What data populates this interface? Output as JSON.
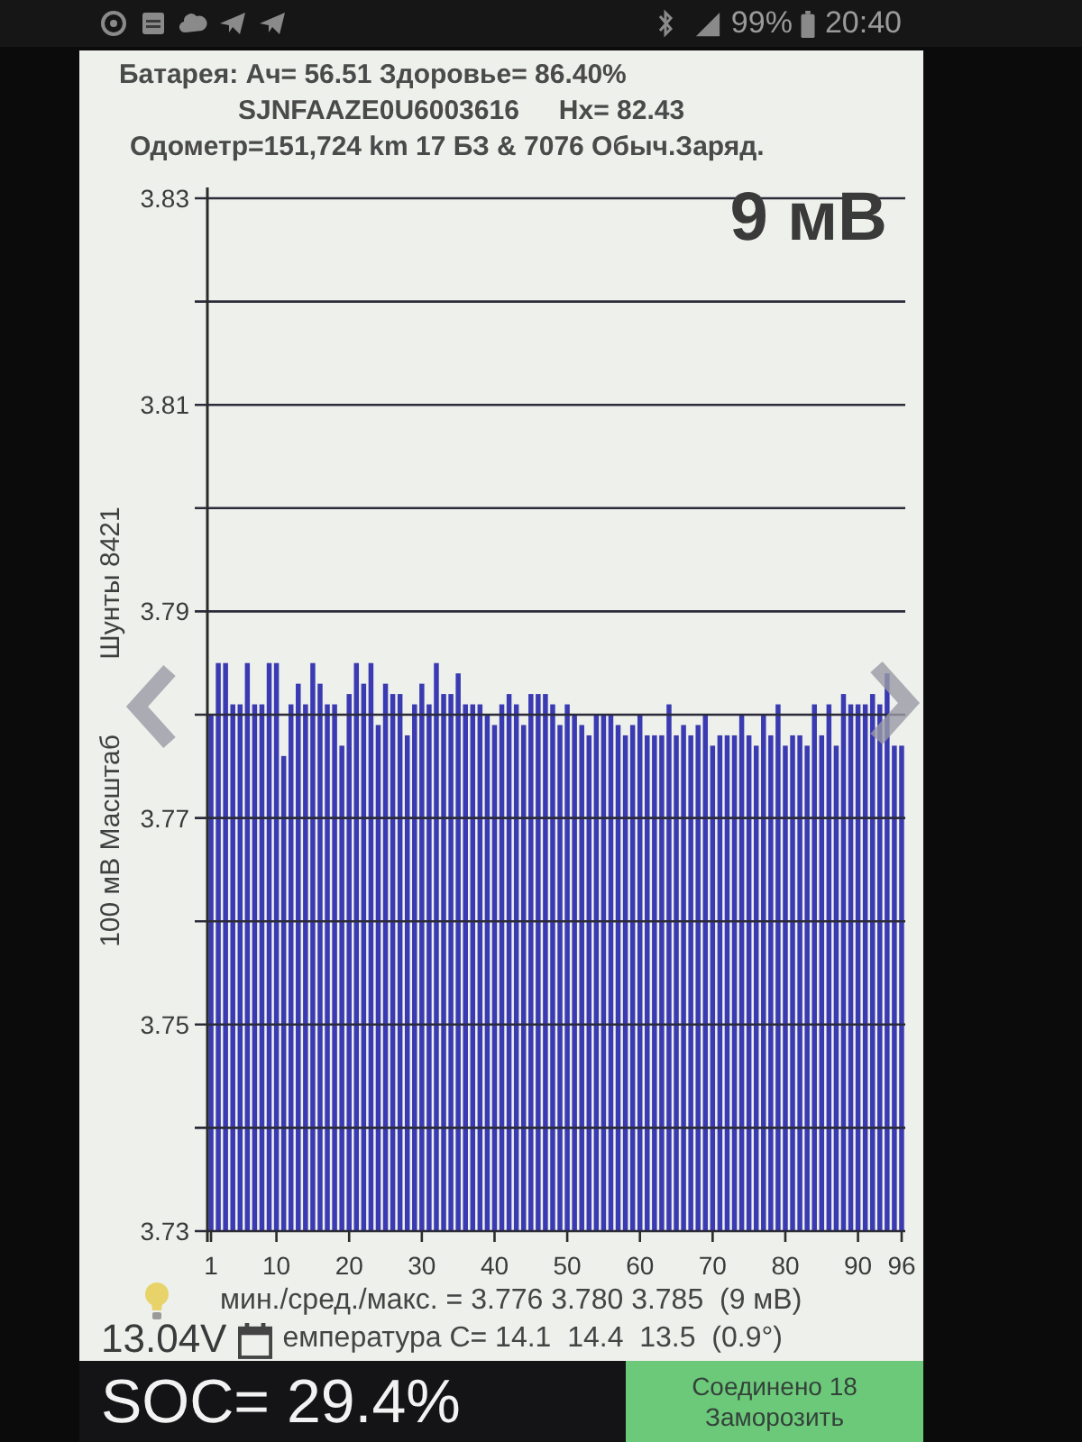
{
  "status_bar": {
    "battery_percent": "99%",
    "time": "20:40"
  },
  "header": {
    "battery_line": "Батарея: Ач= 56.51 Здоровье= 86.40%",
    "vin": "SJNFAAZE0U6003616",
    "hx": "Нх= 82.43",
    "odometer_line": "Одометр=151,724 km 17 БЗ & 7076 Обыч.Заряд."
  },
  "chart": {
    "spread_label": "9 мВ",
    "side_label": "Шунты 8421",
    "chart_data": {
      "type": "bar",
      "ylabel": "100 мВ Масштаб",
      "grid": true,
      "x": [
        1,
        2,
        3,
        4,
        5,
        6,
        7,
        8,
        9,
        10,
        11,
        12,
        13,
        14,
        15,
        16,
        17,
        18,
        19,
        20,
        21,
        22,
        23,
        24,
        25,
        26,
        27,
        28,
        29,
        30,
        31,
        32,
        33,
        34,
        35,
        36,
        37,
        38,
        39,
        40,
        41,
        42,
        43,
        44,
        45,
        46,
        47,
        48,
        49,
        50,
        51,
        52,
        53,
        54,
        55,
        56,
        57,
        58,
        59,
        60,
        61,
        62,
        63,
        64,
        65,
        66,
        67,
        68,
        69,
        70,
        71,
        72,
        73,
        74,
        75,
        76,
        77,
        78,
        79,
        80,
        81,
        82,
        83,
        84,
        85,
        86,
        87,
        88,
        89,
        90,
        91,
        92,
        93,
        94,
        95,
        96
      ],
      "xlim": [
        0.5,
        96.5
      ],
      "ylim": [
        3.73,
        3.83
      ],
      "xticks": [
        1,
        10,
        20,
        30,
        40,
        50,
        60,
        70,
        80,
        90,
        96
      ],
      "yticks": [
        3.73,
        3.75,
        3.77,
        3.79,
        3.81,
        3.83
      ],
      "values": [
        3.78,
        3.785,
        3.785,
        3.781,
        3.781,
        3.785,
        3.781,
        3.781,
        3.785,
        3.785,
        3.776,
        3.781,
        3.783,
        3.781,
        3.785,
        3.783,
        3.781,
        3.781,
        3.777,
        3.782,
        3.785,
        3.783,
        3.785,
        3.779,
        3.783,
        3.782,
        3.782,
        3.778,
        3.781,
        3.783,
        3.781,
        3.785,
        3.782,
        3.782,
        3.784,
        3.781,
        3.781,
        3.781,
        3.78,
        3.779,
        3.781,
        3.782,
        3.781,
        3.779,
        3.782,
        3.782,
        3.782,
        3.781,
        3.779,
        3.781,
        3.78,
        3.779,
        3.778,
        3.78,
        3.78,
        3.78,
        3.779,
        3.778,
        3.779,
        3.78,
        3.778,
        3.778,
        3.778,
        3.781,
        3.778,
        3.779,
        3.778,
        3.779,
        3.78,
        3.777,
        3.778,
        3.778,
        3.778,
        3.78,
        3.778,
        3.777,
        3.78,
        3.778,
        3.781,
        3.777,
        3.778,
        3.778,
        3.777,
        3.781,
        3.778,
        3.781,
        3.777,
        3.782,
        3.781,
        3.781,
        3.781,
        3.782,
        3.781,
        3.784,
        3.777,
        3.777
      ]
    }
  },
  "stats": {
    "min_avg_max": "мин./сред./макс. = 3.776 3.780 3.785  (9 мВ)",
    "voltage": "13.04V",
    "temperature": "емпература C= 14.1  14.4  13.5  (0.9°)"
  },
  "bottom": {
    "soc": "SOC= 29.4%",
    "connection_button": {
      "status": "Соединено 18",
      "label": "Заморозить"
    }
  }
}
